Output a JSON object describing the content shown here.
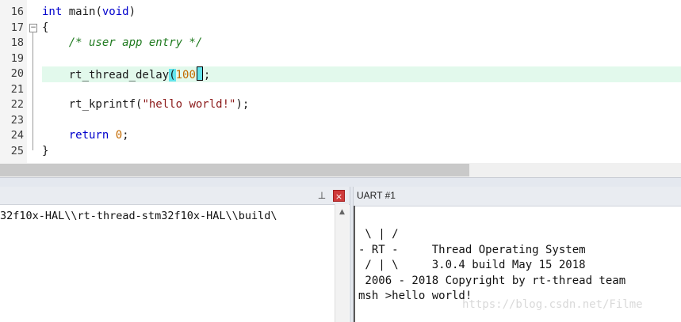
{
  "editor": {
    "lines": [
      {
        "num": "16"
      },
      {
        "num": "17"
      },
      {
        "num": "18"
      },
      {
        "num": "19"
      },
      {
        "num": "20"
      },
      {
        "num": "21"
      },
      {
        "num": "22"
      },
      {
        "num": "23"
      },
      {
        "num": "24"
      },
      {
        "num": "25"
      }
    ],
    "fold_glyph": "−",
    "tokens": {
      "l16_kw": "int",
      "l16_rest": " main(",
      "l16_kw2": "void",
      "l16_end": ")",
      "l17": "{",
      "l18": "    /* user app entry */",
      "l20_fn": "    rt_thread_delay",
      "l20_open": "(",
      "l20_num": "100",
      "l20_end": ";",
      "l22_fn": "    rt_kprintf(",
      "l22_str": "\"hello world!\"",
      "l22_end": ");",
      "l24_kw": "    return",
      "l24_sp": " ",
      "l24_num": "0",
      "l24_end": ";",
      "l25": "}"
    }
  },
  "build_output": {
    "pin_icon": "pin-icon",
    "pin_glyph": "⊥",
    "close_glyph": "×",
    "scroll_up_glyph": "▲",
    "text": "32f10x-HAL\\\\rt-thread-stm32f10x-HAL\\\\build\\"
  },
  "uart": {
    "title": "UART #1",
    "lines": [
      " \\ | /",
      "- RT -     Thread Operating System",
      " / | \\     3.0.4 build May 15 2018",
      " 2006 - 2018 Copyright by rt-thread team",
      "msh >hello world!"
    ]
  },
  "watermark": "https://blog.csdn.net/Filme",
  "colors": {
    "keyword": "#0000cc",
    "comment": "#1f7a1f",
    "string": "#8b1a1a",
    "number": "#c46a00",
    "current_line": "#e2f9ec",
    "bracket_match": "#63e4ec",
    "close_button": "#cf3a3a"
  }
}
